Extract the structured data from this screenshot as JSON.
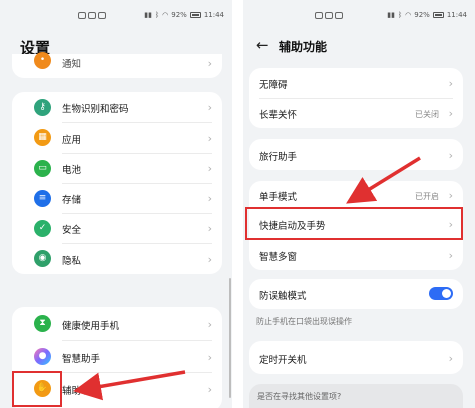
{
  "left": {
    "status": {
      "battery": "92%",
      "time": "11:44"
    },
    "title": "设置",
    "partial_item": "通知",
    "group1": [
      "生物识别和密码",
      "应用",
      "电池",
      "存储",
      "安全",
      "隐私"
    ],
    "group2": [
      "健康使用手机",
      "智慧助手",
      "辅助功能"
    ]
  },
  "right": {
    "status": {
      "battery": "92%",
      "time": "11:44"
    },
    "title": "辅助功能",
    "card1": [
      {
        "label": "无障碍",
        "value": ""
      },
      {
        "label": "长辈关怀",
        "value": "已关闭"
      }
    ],
    "card2": [
      {
        "label": "旅行助手",
        "value": ""
      }
    ],
    "card3": [
      {
        "label": "单手模式",
        "value": "已开启"
      },
      {
        "label": "快捷启动及手势",
        "value": ""
      },
      {
        "label": "智慧多窗",
        "value": ""
      }
    ],
    "card4": {
      "label": "防误触模式",
      "toggle_on": true
    },
    "card4_hint": "防止手机在口袋出现误操作",
    "card5": [
      {
        "label": "定时开关机",
        "value": ""
      }
    ],
    "bottom_hint": "是否在寻找其他设置项?"
  },
  "colors": {
    "accent_red": "#e03030",
    "toggle_blue": "#2d6cf5"
  },
  "icons": {
    "notify": "bell-icon",
    "biometric": "key-icon",
    "apps": "apps-icon",
    "battery": "battery-icon",
    "storage": "storage-icon",
    "security": "shield-icon",
    "privacy": "privacy-icon",
    "health": "hourglass-icon",
    "assistant": "assistant-icon",
    "accessibility": "hand-icon"
  }
}
